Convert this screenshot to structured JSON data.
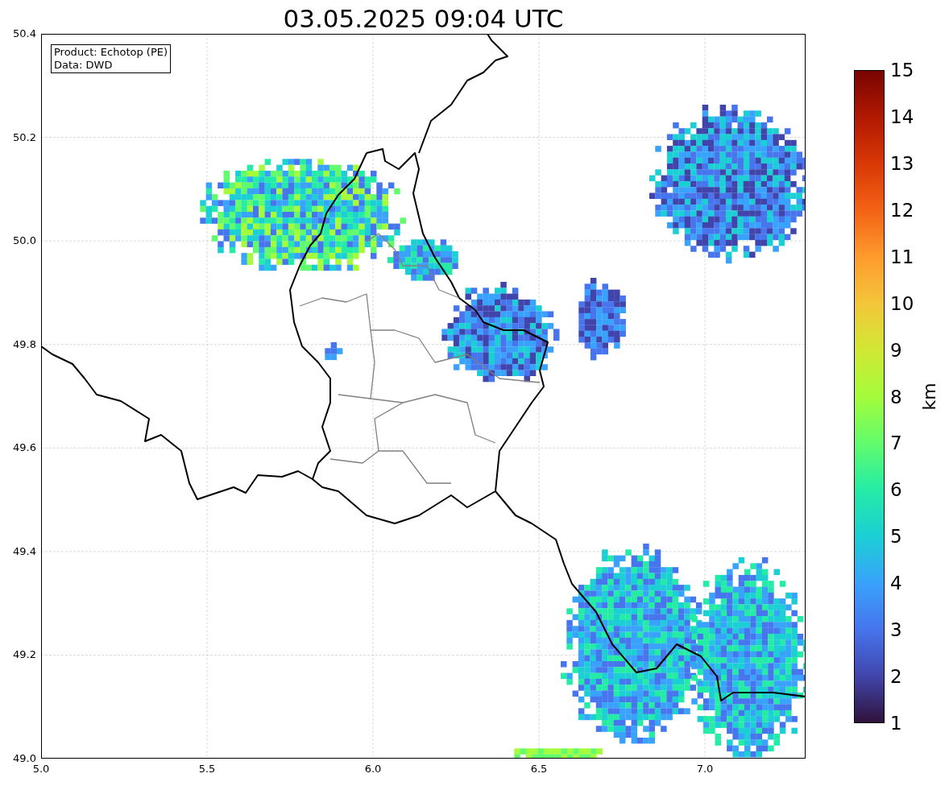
{
  "figure": {
    "title": "03.05.2025 09:04 UTC"
  },
  "map": {
    "info_box": [
      "Product: Echotop (PE)",
      "Data: DWD"
    ],
    "xticks": [
      "5.0",
      "5.5",
      "6.0",
      "6.5",
      "7.0"
    ],
    "yticks": [
      "50.4",
      "50.2",
      "50.0",
      "49.8",
      "49.6",
      "49.4",
      "49.2",
      "49.0"
    ]
  },
  "colorbar": {
    "label": "km",
    "ticks": [
      "15",
      "14",
      "13",
      "12",
      "11",
      "10",
      "9",
      "8",
      "7",
      "6",
      "5",
      "4",
      "3",
      "2",
      "1"
    ]
  }
}
